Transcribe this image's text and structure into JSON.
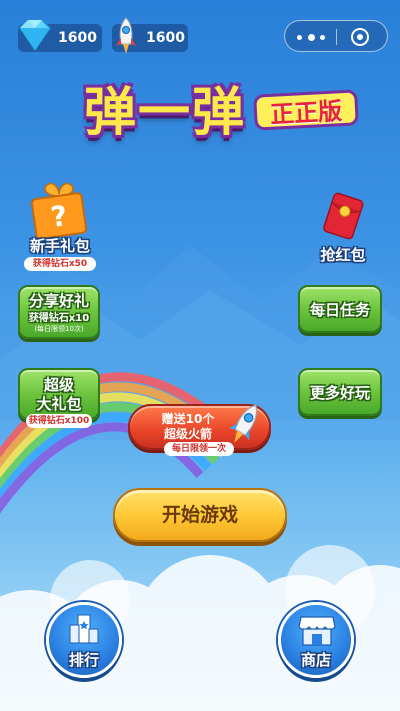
{
  "topbar": {
    "diamonds": "1600",
    "rockets": "1600"
  },
  "title": {
    "main": "弹一弹",
    "badge": "正正版"
  },
  "newbie_gift": {
    "label": "新手礼包",
    "reward": "获得钻石x50"
  },
  "red_packet": {
    "label": "抢红包"
  },
  "share_gift": {
    "label": "分享好礼",
    "reward": "获得钻石x10",
    "limit": "(每日限领10次)"
  },
  "daily_tasks": {
    "label": "每日任务"
  },
  "super_gift": {
    "label_line1": "超级",
    "label_line2": "大礼包",
    "reward": "获得钻石x100"
  },
  "more_fun": {
    "label": "更多好玩"
  },
  "rocket_offer": {
    "line1": "赠送10个",
    "line2": "超级火箭",
    "limit": "每日限领一次"
  },
  "start_button": {
    "label": "开始游戏"
  },
  "ranking": {
    "label": "排行"
  },
  "shop": {
    "label": "商店"
  },
  "colors": {
    "sky_top": "#2a7fd9",
    "green_button": "#6dc43e",
    "start_button": "#ffc936",
    "offer_button": "#e9452a",
    "round_button": "#2a7fe0",
    "title_yellow": "#ffe94a",
    "title_outline": "#7a2fa0"
  },
  "icons": [
    "diamond-icon",
    "rocket-icon",
    "more-dots-icon",
    "close-target-icon",
    "gift-box-icon",
    "red-packet-icon",
    "rank-podium-icon",
    "shop-awning-icon"
  ]
}
